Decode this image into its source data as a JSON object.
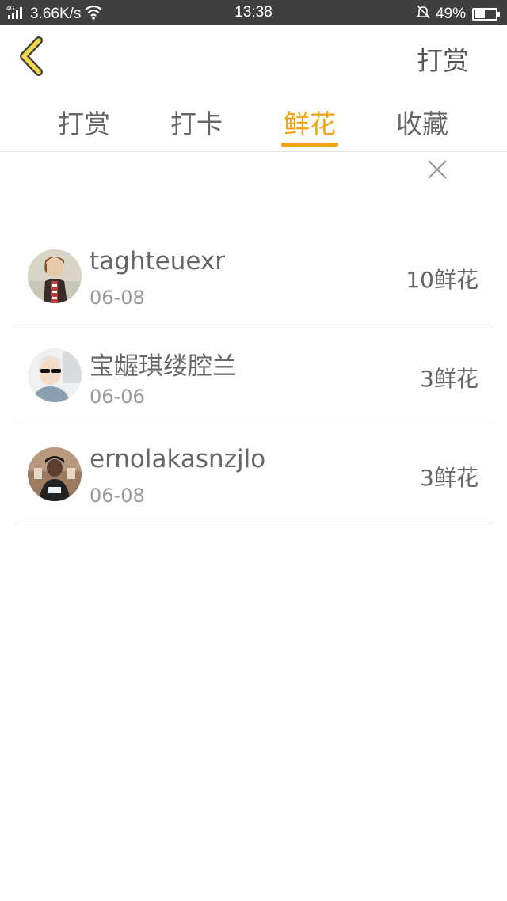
{
  "status_bar": {
    "network": "3.66K/s",
    "time": "13:38",
    "battery": "49%",
    "battery_level": 0.49,
    "icons": [
      "signal-4g-icon",
      "wifi-icon",
      "bell-muted-icon",
      "battery-icon"
    ]
  },
  "nav": {
    "back_icon": "chevron-left-icon",
    "back_color": "#f5d84a",
    "action_label": "打赏"
  },
  "tabs": [
    {
      "label": "打赏",
      "active": false
    },
    {
      "label": "打卡",
      "active": false
    },
    {
      "label": "鲜花",
      "active": true
    },
    {
      "label": "收藏",
      "active": false
    }
  ],
  "accent_color": "#f2a514",
  "list": {
    "items": [
      {
        "name": "taghteuexr",
        "date": "06-08",
        "count": "10鲜花"
      },
      {
        "name": "宝龌琪缕腔兰",
        "date": "06-06",
        "count": "3鲜花"
      },
      {
        "name": "ernolakasnzjlo",
        "date": "06-08",
        "count": "3鲜花"
      }
    ]
  }
}
